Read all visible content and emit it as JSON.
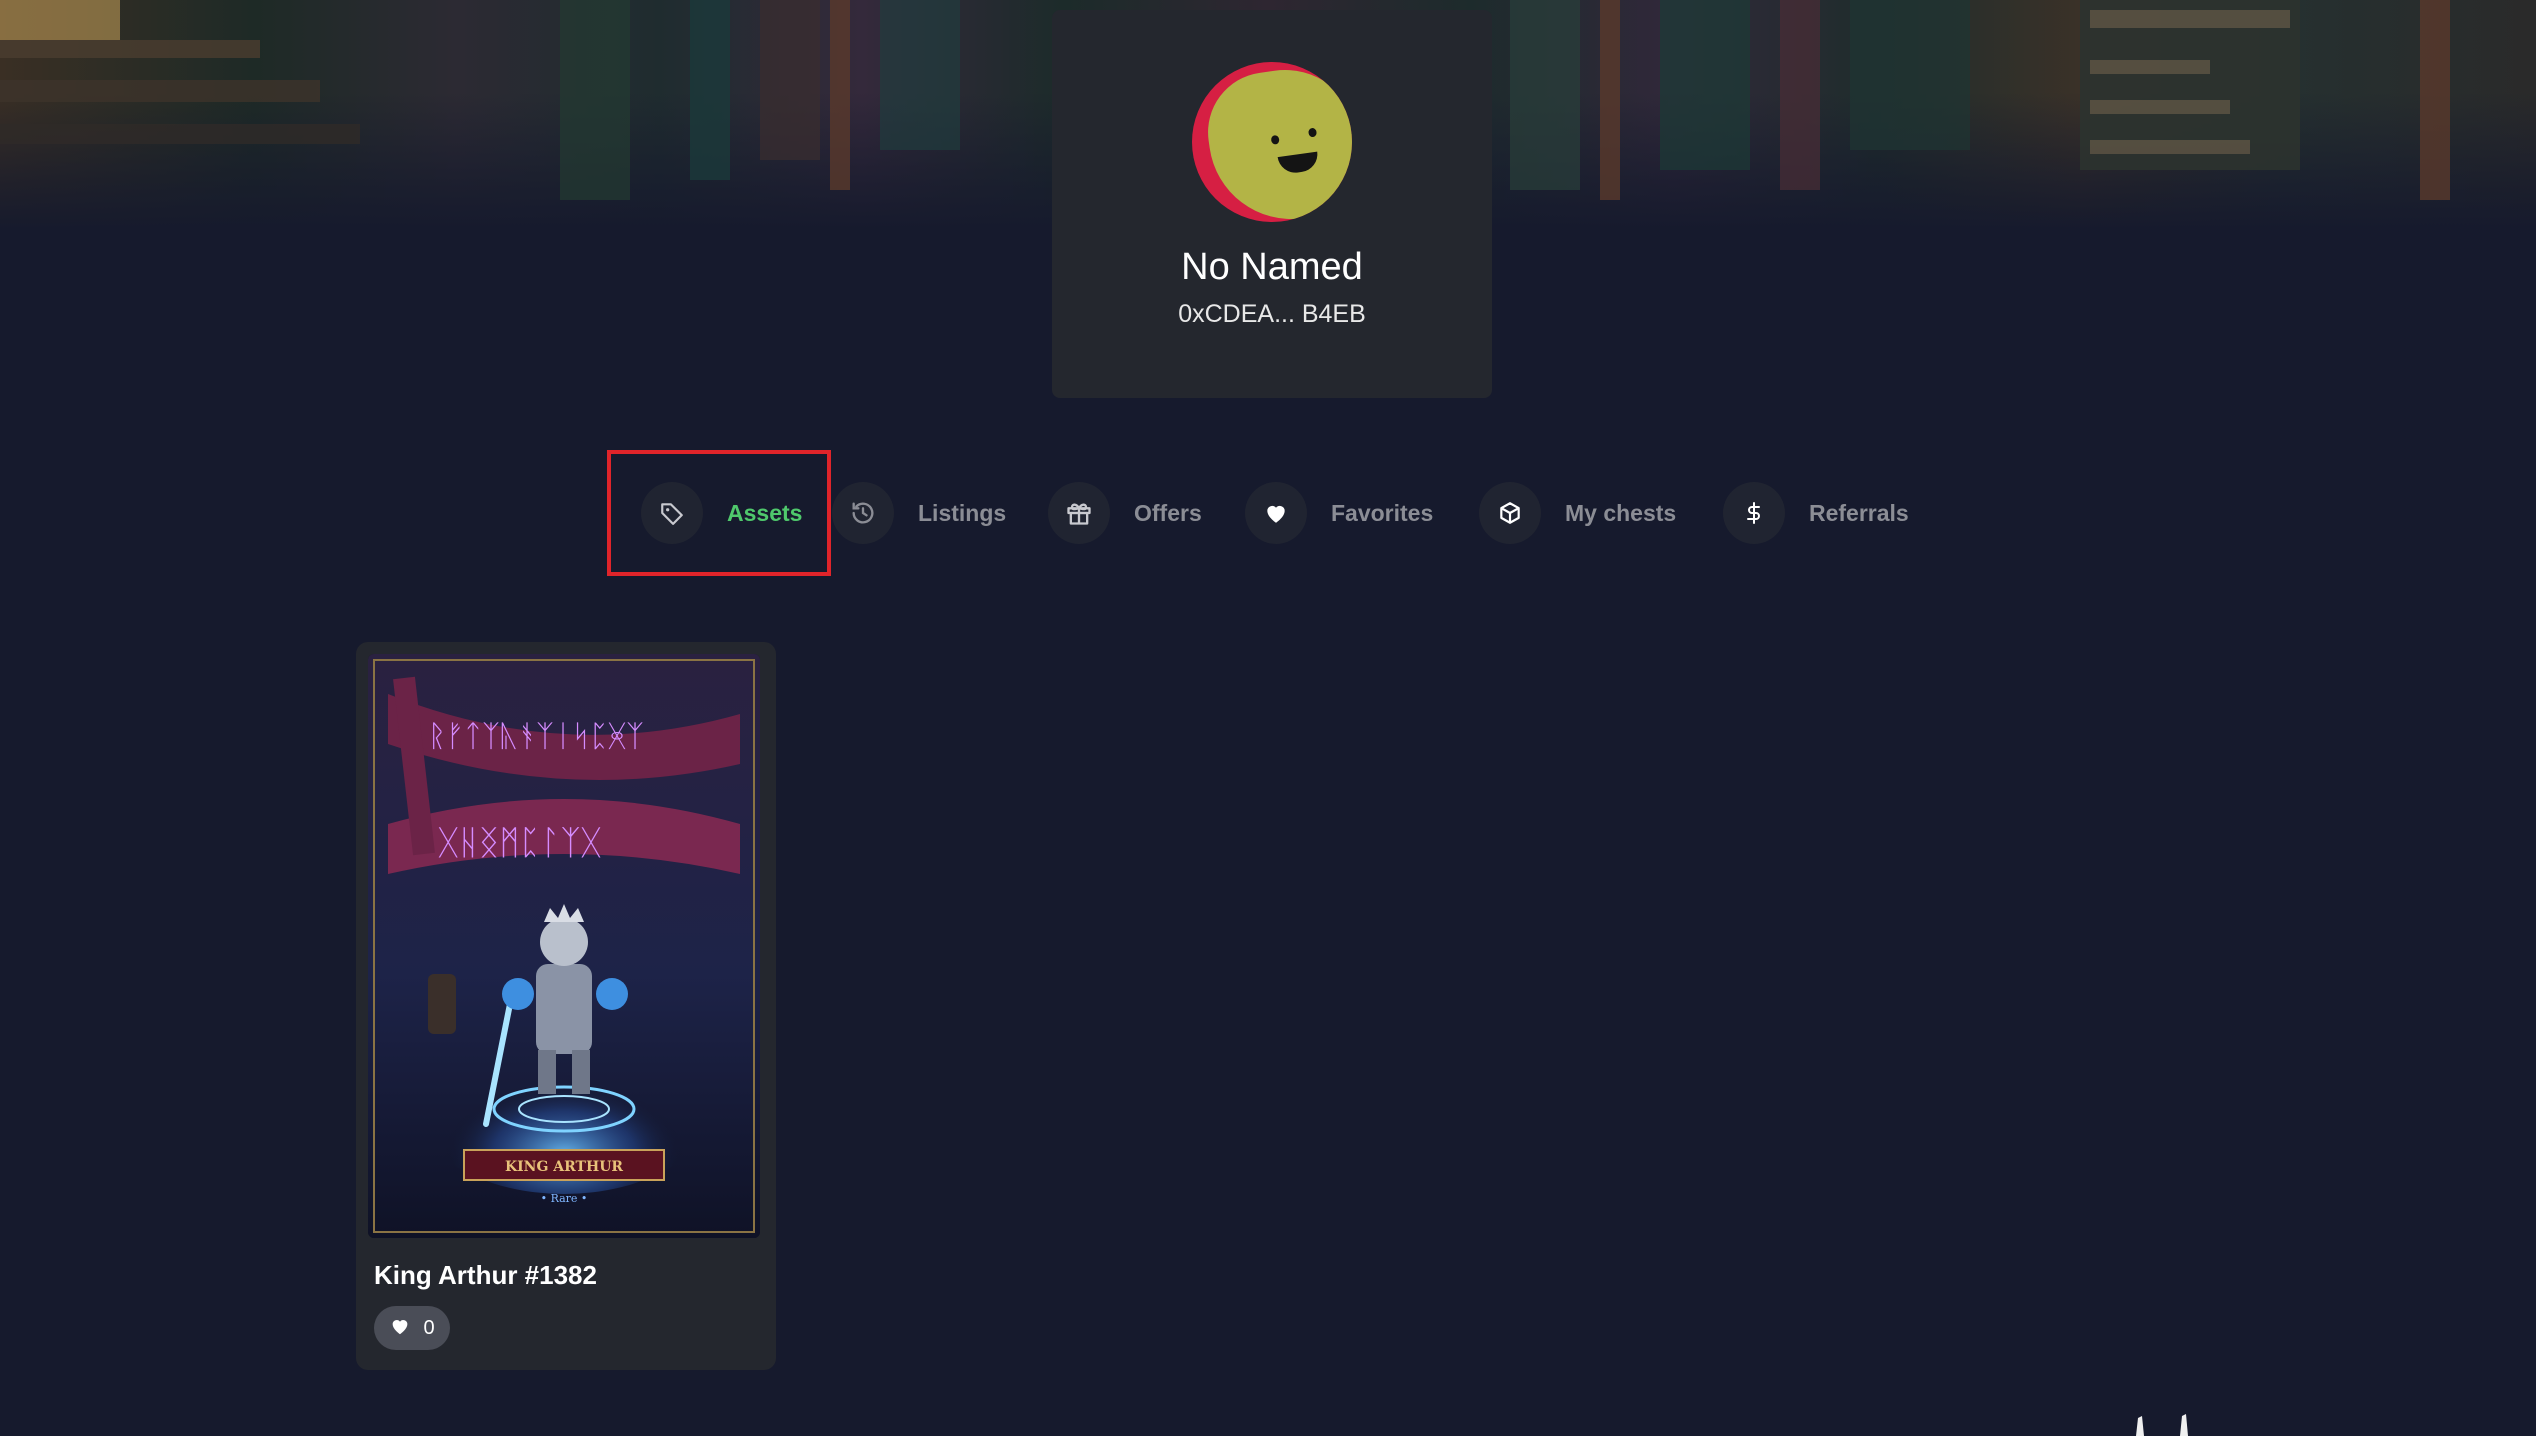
{
  "profile": {
    "name": "No Named",
    "address": "0xCDEA... B4EB",
    "avatar_colors": {
      "background": "#d61f43",
      "face": "#b3b446"
    }
  },
  "tabs": [
    {
      "id": "assets",
      "label": "Assets",
      "icon": "tag-icon",
      "active": true
    },
    {
      "id": "listings",
      "label": "Listings",
      "icon": "clock-icon",
      "active": false
    },
    {
      "id": "offers",
      "label": "Offers",
      "icon": "gift-icon",
      "active": false
    },
    {
      "id": "favorites",
      "label": "Favorites",
      "icon": "heart-icon",
      "active": false
    },
    {
      "id": "my_chests",
      "label": "My chests",
      "icon": "cube-icon",
      "active": false
    },
    {
      "id": "referrals",
      "label": "Referrals",
      "icon": "dollar-icon",
      "active": false
    }
  ],
  "assets": [
    {
      "title": "King Arthur #1382",
      "likes": "0",
      "card_art": {
        "banner_text": "KING ARTHUR",
        "rarity": "• Rare •"
      }
    }
  ],
  "colors": {
    "page_background": "#161a2d",
    "card_background": "#24272e",
    "active_tab": "#4fc86c",
    "inactive_tab": "#8b8d95",
    "highlight": "#e0242a"
  }
}
